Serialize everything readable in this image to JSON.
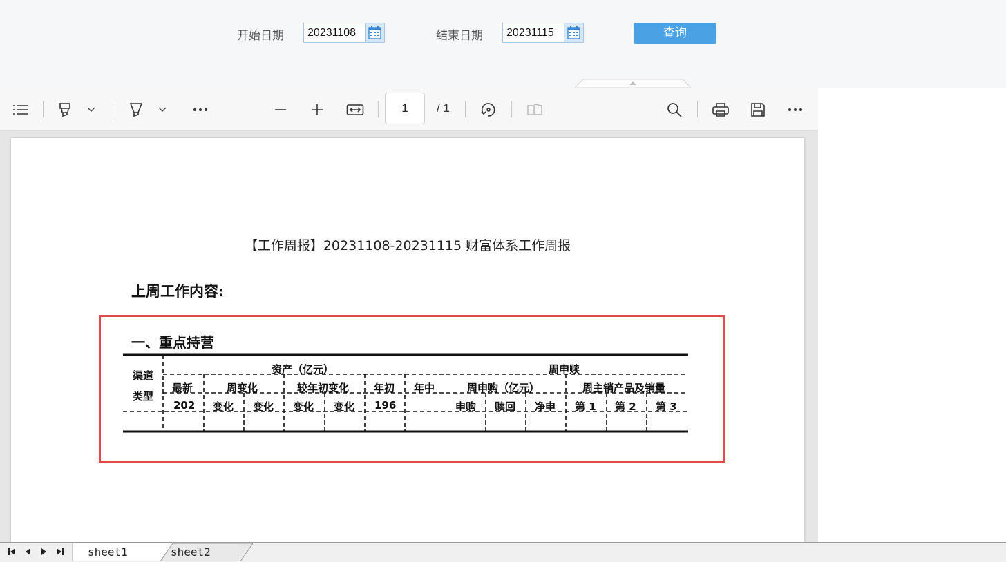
{
  "query": {
    "start_label": "开始日期",
    "start_value": "20231108",
    "end_label": "结束日期",
    "end_value": "20231115",
    "query_button": "查询"
  },
  "toolbar": {
    "page_current": "1",
    "page_total": "/ 1",
    "icons": [
      "list-icon",
      "highlighter-icon",
      "chevron-down-icon",
      "pen-icon",
      "chevron-down-icon",
      "more-icon",
      "zoom-out-icon",
      "zoom-in-icon",
      "fit-width-icon",
      "rotate-icon",
      "page-view-icon",
      "search-icon",
      "print-icon",
      "save-icon",
      "more-icon"
    ]
  },
  "document": {
    "title": "【工作周报】20231108-20231115 财富体系工作周报",
    "section_heading": "上周工作内容:",
    "sub_heading": "一、重点持营",
    "table": {
      "channel_header": [
        "渠道",
        "类型"
      ],
      "group_assets": "资产（亿元）",
      "group_weekly": "周申赎",
      "assets_cols": [
        "最新",
        "周变化",
        "较年初变化",
        "年初",
        "年中"
      ],
      "weekly_cols": [
        "周申购（亿元）",
        "周主销产品及销量"
      ],
      "row3": [
        "202",
        "变化",
        "变化",
        "变化",
        "变化",
        "196",
        "申购",
        "赎回",
        "净申",
        "第 1",
        "第 2",
        "第 3"
      ]
    }
  },
  "sheets": [
    "sheet1",
    "sheet2"
  ],
  "colors": {
    "accent": "#4aa1e4",
    "highlight_border": "#e24a4a",
    "toolbar_bg": "#f7f7f7"
  }
}
